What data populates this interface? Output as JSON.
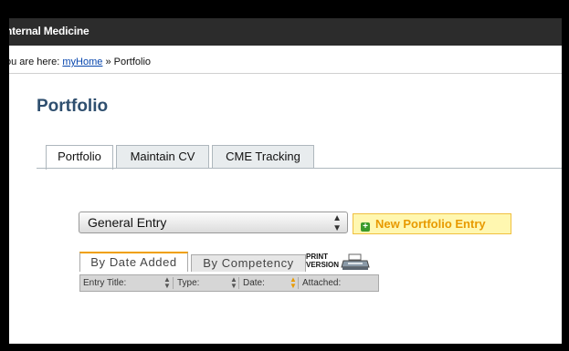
{
  "header": {
    "title": "nternal Medicine"
  },
  "breadcrumb": {
    "prefix": "ou are here:",
    "home_link": "myHome",
    "separator": "»",
    "current": "Portfolio"
  },
  "page": {
    "title": "Portfolio"
  },
  "tabs": [
    {
      "label": "Portfolio",
      "active": true
    },
    {
      "label": "Maintain CV",
      "active": false
    },
    {
      "label": "CME Tracking",
      "active": false
    }
  ],
  "entry_type_select": {
    "selected": "General Entry"
  },
  "new_entry_button": {
    "label": "New Portfolio Entry"
  },
  "view_tabs": [
    {
      "label": "By Date Added",
      "active": true
    },
    {
      "label": "By Competency",
      "active": false
    }
  ],
  "print": {
    "line1": "PRINT",
    "line2": "VERSION"
  },
  "table": {
    "columns": [
      "Entry Title:",
      "Type:",
      "Date:",
      "Attached:"
    ],
    "sorted_column": "Date:"
  },
  "colors": {
    "header_bg": "#2c2c2c",
    "title": "#2f4f6f",
    "accent": "#f0a000",
    "link": "#0645ad"
  }
}
